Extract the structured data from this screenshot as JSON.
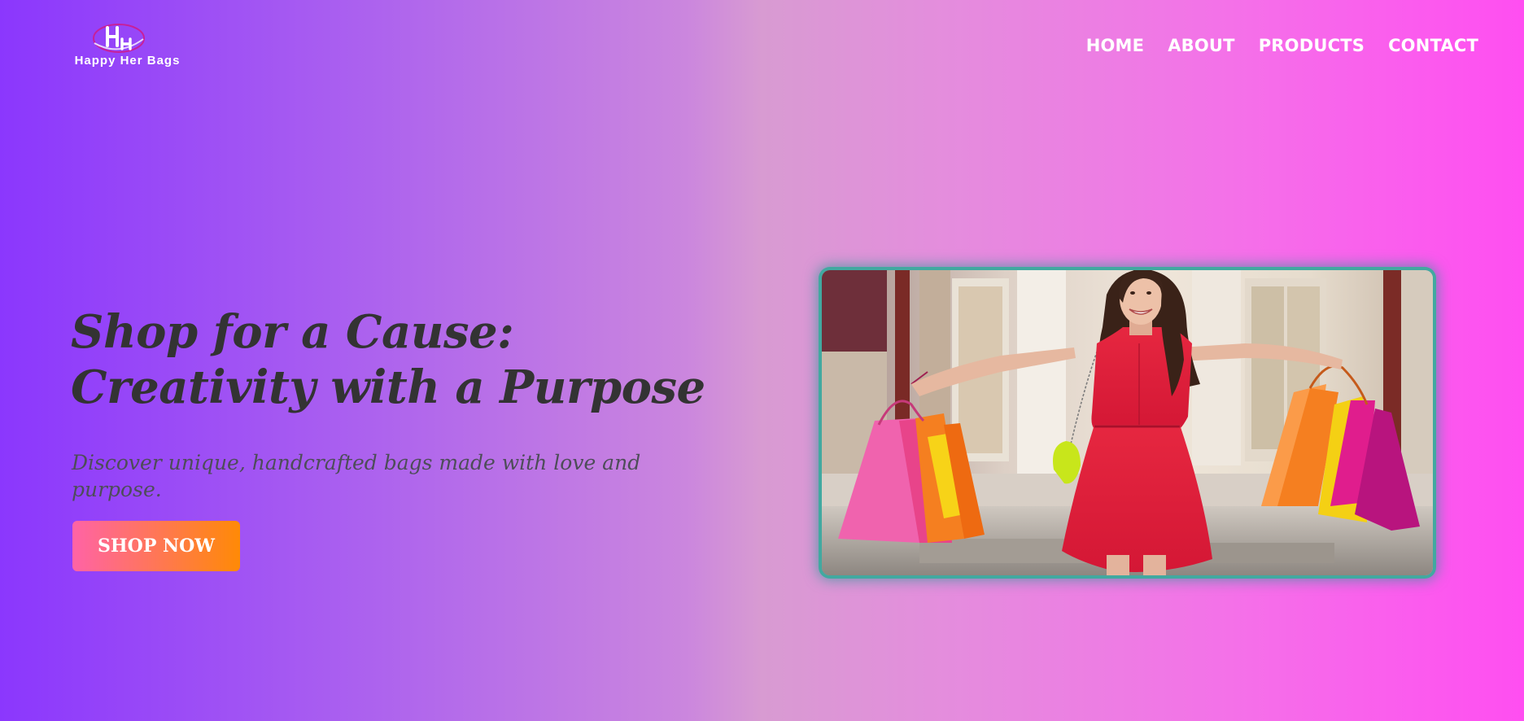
{
  "brand": {
    "monogram": "HH",
    "name": "Happy Her Bags"
  },
  "nav": {
    "items": [
      {
        "label": "HOME"
      },
      {
        "label": "ABOUT"
      },
      {
        "label": "PRODUCTS"
      },
      {
        "label": "CONTACT"
      }
    ]
  },
  "hero": {
    "title_line1": "Shop for a Cause:",
    "title_line2": "Creativity with a Purpose",
    "subtitle": "Discover unique, handcrafted bags made with love and purpose.",
    "cta_label": "SHOP NOW",
    "image_alt": "Smiling woman in a red dress holding colorful shopping bags"
  },
  "colors": {
    "gradient_start": "#8b37fd",
    "gradient_end": "#ff4ef1",
    "text_dark": "#333333",
    "cta_start": "#ff63a6",
    "cta_end": "#ff8a06",
    "image_glow": "#41a9a0"
  }
}
